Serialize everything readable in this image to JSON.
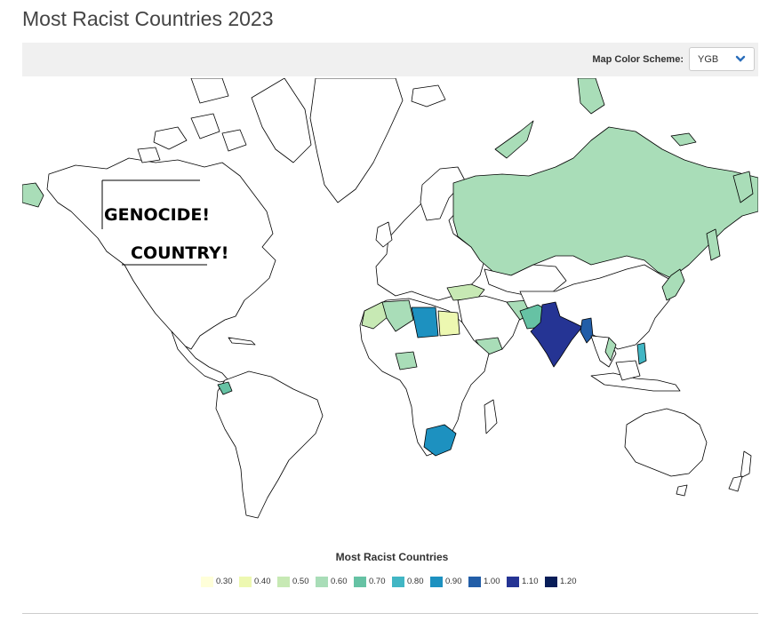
{
  "page": {
    "title": "Most Racist Countries 2023"
  },
  "toolbar": {
    "scheme_label": "Map Color Scheme:",
    "scheme_value": "YGB",
    "chevron_icon": "chevron-down-icon"
  },
  "map": {
    "annotations": [
      "GENOCIDE!",
      "COUNTRY!"
    ],
    "land_default_fill": "#ffffff",
    "border_color": "#000000",
    "shaded_regions": {
      "russia": 0.6,
      "greenland": 0.6,
      "kazakhstan": 0.6,
      "turkey": 0.5,
      "morocco": 0.5,
      "algeria": 0.6,
      "libya": 0.9,
      "egypt": 0.4,
      "india": 1.1,
      "pakistan": 0.7,
      "myanmar": 1.0,
      "saudi-arabia": 0.6,
      "south-africa": 0.9,
      "ecuador": 0.7,
      "japan": 0.6,
      "philippines": 0.8,
      "vietnam": 0.6,
      "iran": 0.6
    }
  },
  "legend": {
    "title": "Most Racist Countries",
    "items": [
      {
        "label": "0.30",
        "color": "#ffffd9"
      },
      {
        "label": "0.40",
        "color": "#edf8b1"
      },
      {
        "label": "0.50",
        "color": "#c7e9b4"
      },
      {
        "label": "0.60",
        "color": "#a9ddb8"
      },
      {
        "label": "0.70",
        "color": "#66c2a4"
      },
      {
        "label": "0.80",
        "color": "#41b6c4"
      },
      {
        "label": "0.90",
        "color": "#1d91c0"
      },
      {
        "label": "1.00",
        "color": "#225ea8"
      },
      {
        "label": "1.10",
        "color": "#253494"
      },
      {
        "label": "1.20",
        "color": "#081d58"
      }
    ]
  }
}
